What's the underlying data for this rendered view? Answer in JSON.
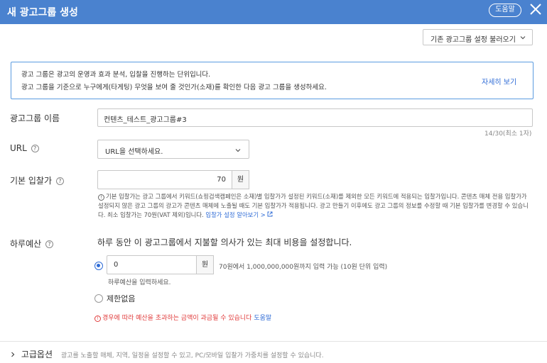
{
  "header": {
    "title": "새 광고그룹 생성",
    "help_label": "도움말"
  },
  "toolbar": {
    "load_settings_label": "기존 광고그룹 설정 불러오기"
  },
  "info": {
    "line1": "광고 그룹은 광고의 운영과 효과 분석, 입찰을 진행하는 단위입니다.",
    "line2": "광고 그룹을 기준으로 누구에게(타게팅) 무엇을 보여 줄 것인가(소재)를 확인한 다음 광고 그룹을 생성하세요.",
    "more_link": "자세히 보기"
  },
  "form": {
    "name": {
      "label": "광고그룹 이름",
      "value": "컨텐츠_테스트_광고그룹#3",
      "counter": "14/30(최소 1자)"
    },
    "url": {
      "label": "URL",
      "placeholder": "URL을 선택하세요."
    },
    "bid": {
      "label": "기본 입찰가",
      "value": "70",
      "unit": "원",
      "help_text": "기본 입찰가는 광고 그룹에서 키워드(쇼핑검색캠페인은 소재)별 입찰가가 설정된 키워드(소재)를 제외한 모든 키워드에 적용되는 입찰가입니다. 콘텐츠 매체 전용 입찰가가 설정되지 않은 광고 그룹의 광고가 콘텐츠 매체에 노출될 때도 기본 입찰가가 적용됩니다. 광고 만들기 이후에도 광고 그룹의 정보를 수정할 때 기본 입찰가를 변경할 수 있습니다. 최소 입찰가는 70원(VAT 제외)입니다.",
      "help_link": "입찰가 설정 알아보기 >"
    },
    "budget": {
      "label": "하루예산",
      "description": "하루 동안 이 광고그룹에서 지불할 의사가 있는 최대 비용을 설정합니다.",
      "value": "0",
      "unit": "원",
      "range_text": "70원에서 1,000,000,000원까지 입력 가능 (10원 단위 입력)",
      "hint": "하루예산을 입력하세요.",
      "unlimited_label": "제한없음",
      "warning": "경우에 따라 예산을 초과하는 금액이 과금될 수 있습니다",
      "warning_link": "도움말"
    }
  },
  "advanced": {
    "title": "고급옵션",
    "description": "광고를 노출할 매체, 지역, 일정을 설정할 수 있고, PC/모바일 입찰가 가중치를 설정할 수 있습니다."
  },
  "colors": {
    "header_bg": "#4a82cf",
    "accent": "#2e6bd6",
    "warning": "#e03b3b"
  }
}
